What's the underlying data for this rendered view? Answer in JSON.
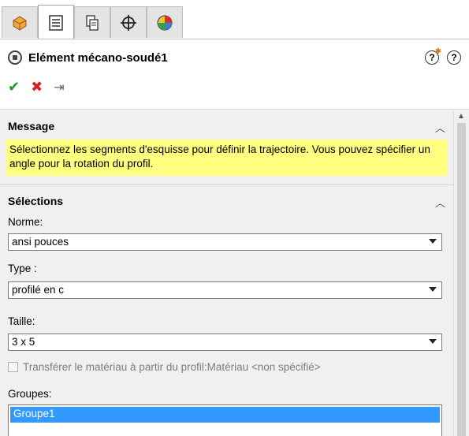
{
  "tabs": [
    {
      "icon": "feature-manager-icon"
    },
    {
      "icon": "property-manager-icon"
    },
    {
      "icon": "configuration-manager-icon"
    },
    {
      "icon": "dimxpert-icon"
    },
    {
      "icon": "display-manager-icon"
    }
  ],
  "header": {
    "title": "Elément mécano-soudé1",
    "help_icons": [
      "whats-new-icon",
      "help-icon"
    ],
    "actions": [
      "ok-icon",
      "cancel-icon",
      "pin-icon"
    ]
  },
  "message": {
    "heading": "Message",
    "text": "Sélectionnez les segments d'esquisse pour définir la trajectoire. Vous pouvez spécifier un angle pour la rotation du profil."
  },
  "selections": {
    "heading": "Sélections",
    "norme_label": "Norme:",
    "norme_value": "ansi pouces",
    "type_label": "Type :",
    "type_value": "profilé en c",
    "taille_label": "Taille:",
    "taille_value": "3 x 5",
    "transfer_label": "Transférer le matériau à partir du profil:Matériau <non spécifié>",
    "transfer_checked": false,
    "groupes_label": "Groupes:",
    "groupes": [
      "Groupe1"
    ]
  },
  "colors": {
    "message_bg": "#ffff80",
    "selection": "#3399ff",
    "ok": "#1f9e1f",
    "cancel": "#d62020"
  }
}
